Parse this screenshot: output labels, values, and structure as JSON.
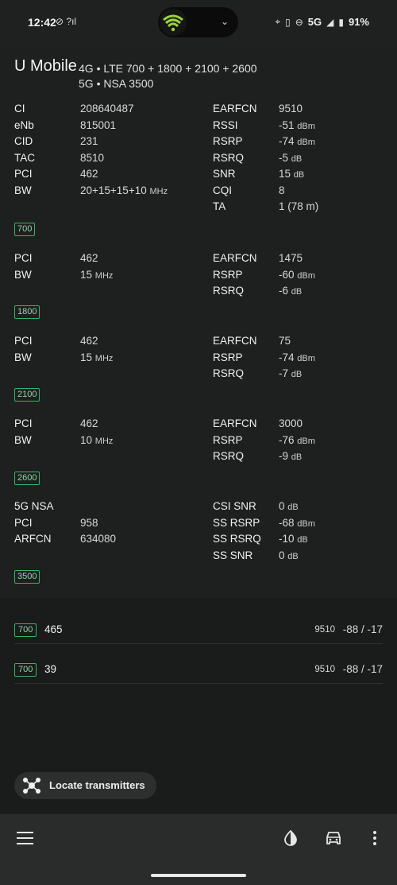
{
  "status_bar": {
    "time": "12:42",
    "left_icons": "⊘ ?ıl",
    "network": "5G",
    "battery": "91%"
  },
  "header": {
    "operator": "U Mobile",
    "bands_line1": "4G • LTE 700 + 1800 + 2100 + 2600",
    "bands_line2": "5G • NSA 3500"
  },
  "primary": {
    "left": [
      {
        "label": "CI",
        "value": "208640487",
        "unit": ""
      },
      {
        "label": "eNb",
        "value": "815001",
        "unit": ""
      },
      {
        "label": "CID",
        "value": "231",
        "unit": ""
      },
      {
        "label": "TAC",
        "value": "8510",
        "unit": ""
      },
      {
        "label": "PCI",
        "value": "462",
        "unit": ""
      },
      {
        "label": "BW",
        "value": "20+15+15+10",
        "unit": "MHz"
      }
    ],
    "right": [
      {
        "label": "EARFCN",
        "value": "9510",
        "unit": ""
      },
      {
        "label": "RSSI",
        "value": "-51",
        "unit": "dBm"
      },
      {
        "label": "RSRP",
        "value": "-74",
        "unit": "dBm"
      },
      {
        "label": "RSRQ",
        "value": "-5",
        "unit": "dB"
      },
      {
        "label": "SNR",
        "value": "15",
        "unit": "dB"
      },
      {
        "label": "CQI",
        "value": "8",
        "unit": ""
      },
      {
        "label": "TA",
        "value": "1 (78 m)",
        "unit": ""
      }
    ],
    "band_tag": "700"
  },
  "carriers": [
    {
      "left": [
        {
          "label": "PCI",
          "value": "462",
          "unit": ""
        },
        {
          "label": "BW",
          "value": "15",
          "unit": "MHz"
        }
      ],
      "right": [
        {
          "label": "EARFCN",
          "value": "1475",
          "unit": ""
        },
        {
          "label": "RSRP",
          "value": "-60",
          "unit": "dBm"
        },
        {
          "label": "RSRQ",
          "value": "-6",
          "unit": "dB"
        }
      ],
      "band_tag": "1800"
    },
    {
      "left": [
        {
          "label": "PCI",
          "value": "462",
          "unit": ""
        },
        {
          "label": "BW",
          "value": "15",
          "unit": "MHz"
        }
      ],
      "right": [
        {
          "label": "EARFCN",
          "value": "75",
          "unit": ""
        },
        {
          "label": "RSRP",
          "value": "-74",
          "unit": "dBm"
        },
        {
          "label": "RSRQ",
          "value": "-7",
          "unit": "dB"
        }
      ],
      "band_tag": "2100"
    },
    {
      "left": [
        {
          "label": "PCI",
          "value": "462",
          "unit": ""
        },
        {
          "label": "BW",
          "value": "10",
          "unit": "MHz"
        }
      ],
      "right": [
        {
          "label": "EARFCN",
          "value": "3000",
          "unit": ""
        },
        {
          "label": "RSRP",
          "value": "-76",
          "unit": "dBm"
        },
        {
          "label": "RSRQ",
          "value": "-9",
          "unit": "dB"
        }
      ],
      "band_tag": "2600"
    }
  ],
  "nsa": {
    "left": [
      {
        "label": "5G NSA",
        "value": "",
        "unit": ""
      },
      {
        "label": "PCI",
        "value": "958",
        "unit": ""
      },
      {
        "label": "ARFCN",
        "value": "634080",
        "unit": ""
      }
    ],
    "right": [
      {
        "label": "CSI SNR",
        "value": "0",
        "unit": "dB"
      },
      {
        "label": "SS RSRP",
        "value": "-68",
        "unit": "dBm"
      },
      {
        "label": "SS RSRQ",
        "value": "-10",
        "unit": "dB"
      },
      {
        "label": "SS SNR",
        "value": "0",
        "unit": "dB"
      }
    ],
    "band_tag": "3500"
  },
  "neighbours": [
    {
      "band": "700",
      "pci": "465",
      "earfcn": "9510",
      "signal": "-88 / -17"
    },
    {
      "band": "700",
      "pci": "39",
      "earfcn": "9510",
      "signal": "-88 / -17"
    }
  ],
  "locate_button": "Locate transmitters",
  "colors": {
    "background": "#1e1f1f",
    "tag_border": "#35b46a",
    "bottom_bar": "#2a2b2b"
  }
}
